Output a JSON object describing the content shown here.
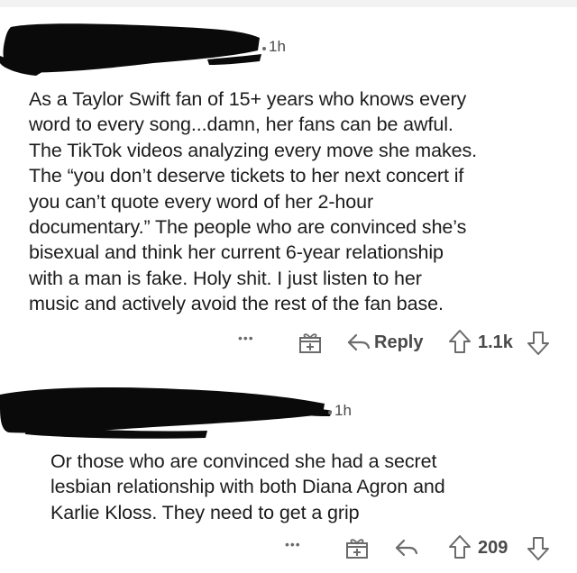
{
  "comments": [
    {
      "username": "",
      "timestamp": "1h",
      "body": "As a Taylor Swift fan of 15+ years who knows every\nword to every song...damn, her fans can be awful.\nThe TikTok videos analyzing every move she makes.\nThe “you don’t deserve tickets to her next concert if\nyou can’t quote every word of her 2-hour\ndocumentary.” The people who are convinced she’s\nbisexual and think her current 6-year relationship\nwith a man is fake. Holy shit. I just listen to her\nmusic and actively avoid the rest of the fan base.",
      "actions": {
        "more": "•••",
        "award_icon": "gift-plus-icon",
        "reply_icon": "reply-arrow-icon",
        "reply_label": "Reply",
        "upvote_icon": "upvote-arrow-icon",
        "score": "1.1k",
        "downvote_icon": "downvote-arrow-icon"
      }
    },
    {
      "username": "",
      "timestamp": "1h",
      "body": "Or those who are convinced she had a secret\nlesbian relationship with both Diana Agron and\nKarlie Kloss. They need to get a grip",
      "actions": {
        "more": "•••",
        "award_icon": "gift-plus-icon",
        "reply_icon": "reply-arrow-icon",
        "reply_label": "",
        "upvote_icon": "upvote-arrow-icon",
        "score": "209",
        "downvote_icon": "downvote-arrow-icon"
      }
    }
  ],
  "colors": {
    "text": "#1c1c1c",
    "meta": "#4a4a4a",
    "redaction": "#0a0a0a"
  }
}
